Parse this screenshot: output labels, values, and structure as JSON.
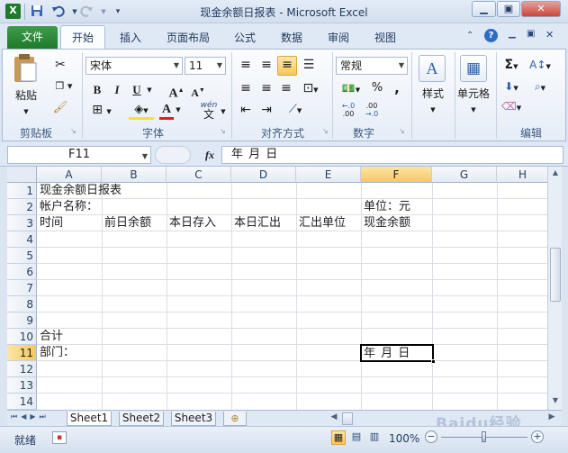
{
  "window": {
    "title": "现金余额日报表 - Microsoft Excel",
    "app_icon": "excel-icon",
    "controls": [
      "minimize-icon",
      "restore-icon",
      "close-icon"
    ]
  },
  "quick_access": [
    "save-icon",
    "undo-icon",
    "redo-icon",
    "customize-icon"
  ],
  "tabs": [
    "文件",
    "开始",
    "插入",
    "页面布局",
    "公式",
    "数据",
    "审阅",
    "视图"
  ],
  "active_tab": "开始",
  "ribbon": {
    "clipboard": {
      "paste_label": "粘贴",
      "group_label": "剪贴板"
    },
    "font": {
      "font_name": "宋体",
      "font_size": "11",
      "bold": "B",
      "italic": "I",
      "underline": "U",
      "grow": "A",
      "shrink": "A",
      "font_color_glyph": "A",
      "wen": "wén",
      "wen_char": "文",
      "group_label": "字体"
    },
    "alignment": {
      "group_label": "对齐方式"
    },
    "number": {
      "format": "常规",
      "percent": "%",
      "comma": ",",
      "inc_decimal": "+.0\n.00",
      "dec_decimal": ".00\n+.0",
      "group_label": "数字"
    },
    "styles": {
      "label": "样式"
    },
    "cells": {
      "label": "单元格"
    },
    "editing": {
      "sum": "Σ",
      "group_label": "编辑"
    },
    "accent_color": "#1f7a2c",
    "highlight_color": "#f5c862",
    "font_color": "#e21d1d"
  },
  "formula_bar": {
    "name_box": "F11",
    "fx": "fx",
    "content": "年   月   日"
  },
  "sheet": {
    "columns": [
      "A",
      "B",
      "C",
      "D",
      "E",
      "F",
      "G",
      "H"
    ],
    "rows": [
      "1",
      "2",
      "3",
      "4",
      "5",
      "6",
      "7",
      "8",
      "9",
      "10",
      "11",
      "12",
      "13",
      "14"
    ],
    "selected_cell": "F11",
    "cells": {
      "A1": "现金余额日报表",
      "A2": "帐户名称：",
      "F2": "单位：元",
      "A3": "时间",
      "B3": "前日余额",
      "C3": "本日存入",
      "D3": "本日汇出",
      "E3": "汇出单位",
      "F3": "现金余额",
      "A10": "合计",
      "A11": "部门：",
      "F11": "年   月   日"
    }
  },
  "sheet_tabs": [
    "Sheet1",
    "Sheet2",
    "Sheet3"
  ],
  "active_sheet": "Sheet1",
  "status": {
    "mode": "就绪",
    "zoom": "100%",
    "watermark": "Baidu经验"
  }
}
